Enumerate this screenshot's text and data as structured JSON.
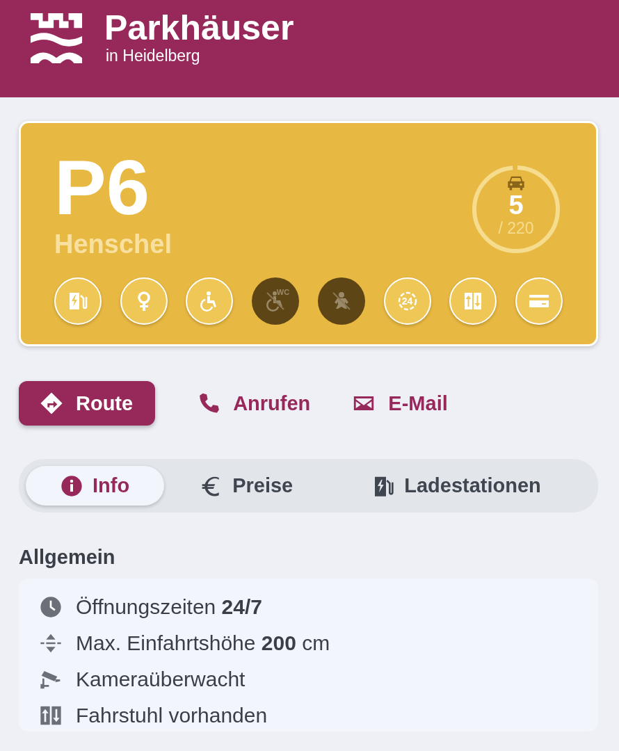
{
  "header": {
    "title": "Parkhäuser",
    "subtitle": "in Heidelberg"
  },
  "garage": {
    "code": "P6",
    "name": "Henschel",
    "free": "5",
    "capacity": "/ 220",
    "level": 0.98,
    "features": [
      {
        "kind": "ev-charging",
        "available": true
      },
      {
        "kind": "women",
        "available": true
      },
      {
        "kind": "accessible",
        "available": true
      },
      {
        "kind": "accessible-wc",
        "available": false,
        "label": "WC"
      },
      {
        "kind": "baby",
        "available": false
      },
      {
        "kind": "allday",
        "available": true,
        "label": "24"
      },
      {
        "kind": "elevator",
        "available": true
      },
      {
        "kind": "card",
        "available": true
      }
    ]
  },
  "actions": [
    {
      "kind": "route",
      "label": "Route",
      "primary": true
    },
    {
      "kind": "phone",
      "label": "Anrufen",
      "primary": false
    },
    {
      "kind": "mail",
      "label": "E-Mail",
      "primary": false
    }
  ],
  "tabs": [
    {
      "kind": "info",
      "label": "Info",
      "selected": true
    },
    {
      "kind": "prices",
      "label": "Preise",
      "selected": false
    },
    {
      "kind": "charging",
      "label": "Ladestationen",
      "selected": false
    }
  ],
  "section": {
    "title": "Allgemein",
    "items": [
      {
        "kind": "clock",
        "text": "Öffnungszeiten **24/7**"
      },
      {
        "kind": "height",
        "text": "Max. Einfahrtshöhe **200** cm"
      },
      {
        "kind": "camera",
        "text": "Kameraüberwacht"
      },
      {
        "kind": "elevator",
        "text": "Fahrstuhl vorhanden"
      }
    ]
  }
}
